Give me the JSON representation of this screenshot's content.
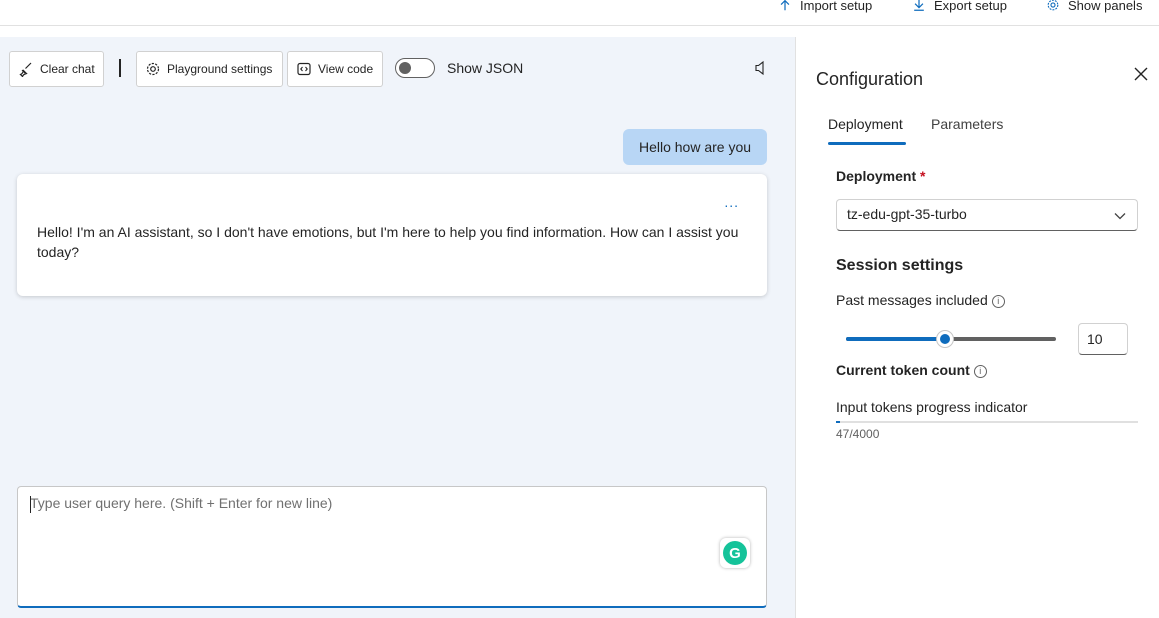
{
  "top_actions": {
    "import_label": "Import setup",
    "export_label": "Export setup",
    "panels_label": "Show panels"
  },
  "toolbar": {
    "clear_chat": "Clear chat",
    "playground_settings": "Playground settings",
    "view_code": "View code",
    "show_json_label": "Show JSON",
    "show_json_on": false
  },
  "chat": {
    "user_message": "Hello how are you",
    "assistant_message": "Hello! I'm an AI assistant, so I don't have emotions, but I'm here to help you find information. How can I assist you today?",
    "more_label": "...",
    "query_placeholder": "Type user query here. (Shift + Enter for new line)"
  },
  "config": {
    "title": "Configuration",
    "tabs": [
      {
        "label": "Deployment",
        "active": true
      },
      {
        "label": "Parameters",
        "active": false
      }
    ],
    "deployment_label": "Deployment",
    "required_mark": "*",
    "deployment_value": "tz-edu-gpt-35-turbo",
    "session_title": "Session settings",
    "past_messages_label": "Past messages included",
    "past_messages_value": "10",
    "past_messages_fraction": 0.47,
    "token_count_label": "Current token count",
    "progress_label": "Input tokens progress indicator",
    "token_progress": "47/4000",
    "token_used": 47,
    "token_max": 4000
  },
  "colors": {
    "accent": "#0f6cbd",
    "user_bubble": "#b8d6f5",
    "chat_bg": "#f0f4fa"
  }
}
